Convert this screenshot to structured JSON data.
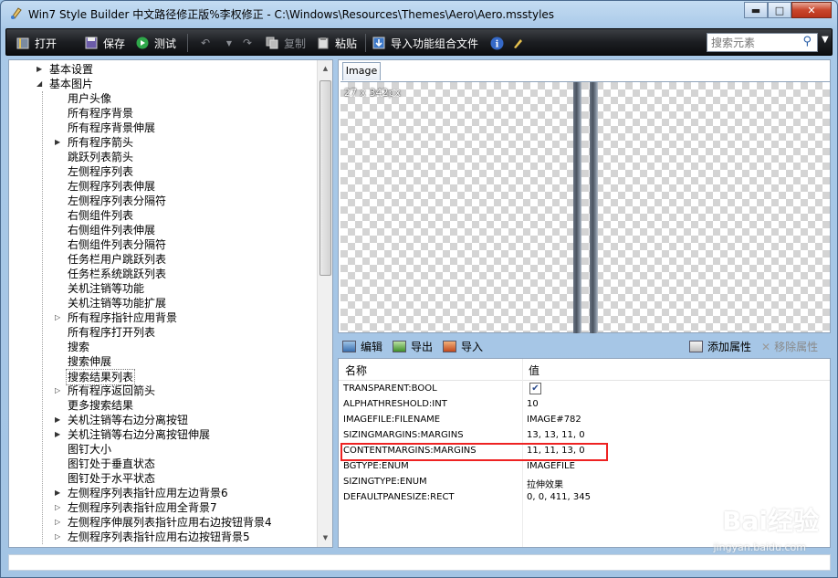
{
  "window": {
    "title": "Win7 Style Builder 中文路径修正版%李权修正 - C:\\Windows\\Resources\\Themes\\Aero\\Aero.msstyles",
    "minimize": "▬",
    "maximize": "□",
    "close": "✕"
  },
  "toolbar": {
    "open_label": "打开",
    "save_label": "保存",
    "test_label": "测试",
    "copy_label": "复制",
    "paste_label": "粘贴",
    "import_combo_label": "导入功能组合文件",
    "search_placeholder": "搜索元素"
  },
  "tree": {
    "items": [
      {
        "label": "基本设置",
        "arrow": "▶",
        "level": 0
      },
      {
        "label": "基本图片",
        "arrow": "◢",
        "level": 0
      },
      {
        "label": "用户头像",
        "arrow": "",
        "level": 1
      },
      {
        "label": "所有程序背景",
        "arrow": "",
        "level": 1
      },
      {
        "label": "所有程序背景伸展",
        "arrow": "",
        "level": 1
      },
      {
        "label": "所有程序箭头",
        "arrow": "▶",
        "level": 1
      },
      {
        "label": "跳跃列表箭头",
        "arrow": "",
        "level": 1
      },
      {
        "label": "左侧程序列表",
        "arrow": "",
        "level": 1
      },
      {
        "label": "左侧程序列表伸展",
        "arrow": "",
        "level": 1
      },
      {
        "label": "左侧程序列表分隔符",
        "arrow": "",
        "level": 1
      },
      {
        "label": "右侧组件列表",
        "arrow": "",
        "level": 1
      },
      {
        "label": "右侧组件列表伸展",
        "arrow": "",
        "level": 1
      },
      {
        "label": "右侧组件列表分隔符",
        "arrow": "",
        "level": 1
      },
      {
        "label": "任务栏用户跳跃列表",
        "arrow": "",
        "level": 1
      },
      {
        "label": "任务栏系统跳跃列表",
        "arrow": "",
        "level": 1
      },
      {
        "label": "关机注销等功能",
        "arrow": "",
        "level": 1
      },
      {
        "label": "关机注销等功能扩展",
        "arrow": "",
        "level": 1
      },
      {
        "label": "所有程序指针应用背景",
        "arrow": "▷",
        "level": 1
      },
      {
        "label": "所有程序打开列表",
        "arrow": "",
        "level": 1
      },
      {
        "label": "搜索",
        "arrow": "",
        "level": 1
      },
      {
        "label": "搜索伸展",
        "arrow": "",
        "level": 1
      },
      {
        "label": "搜索结果列表",
        "arrow": "",
        "level": 1,
        "selected": true
      },
      {
        "label": "所有程序返回箭头",
        "arrow": "▷",
        "level": 1
      },
      {
        "label": "更多搜索结果",
        "arrow": "",
        "level": 1
      },
      {
        "label": "关机注销等右边分离按钮",
        "arrow": "▶",
        "level": 1
      },
      {
        "label": "关机注销等右边分离按钮伸展",
        "arrow": "▶",
        "level": 1
      },
      {
        "label": "图钉大小",
        "arrow": "",
        "level": 1
      },
      {
        "label": "图钉处于垂直状态",
        "arrow": "",
        "level": 1
      },
      {
        "label": "图钉处于水平状态",
        "arrow": "",
        "level": 1
      },
      {
        "label": "左侧程序列表指针应用左边背景6",
        "arrow": "▶",
        "level": 1
      },
      {
        "label": "左侧程序列表指针应用全背景7",
        "arrow": "▷",
        "level": 1
      },
      {
        "label": "左侧程序伸展列表指针应用右边按钮背景4",
        "arrow": "▷",
        "level": 1
      },
      {
        "label": "左侧程序列表指针应用右边按钮背景5",
        "arrow": "▷",
        "level": 1
      }
    ]
  },
  "image_tab": {
    "label": "Image",
    "size_text": "27 x 342px"
  },
  "prop_toolbar": {
    "edit_label": "编辑",
    "export_label": "导出",
    "import_label": "导入",
    "add_prop_label": "添加属性",
    "remove_prop_label": "移除属性"
  },
  "props": {
    "header_name": "名称",
    "header_value": "值",
    "rows": [
      {
        "name": "TRANSPARENT:BOOL",
        "value": "",
        "checkbox": true
      },
      {
        "name": "ALPHATHRESHOLD:INT",
        "value": "10"
      },
      {
        "name": "IMAGEFILE:FILENAME",
        "value": "IMAGE#782"
      },
      {
        "name": "SIZINGMARGINS:MARGINS",
        "value": "13, 13, 11, 0"
      },
      {
        "name": "CONTENTMARGINS:MARGINS",
        "value": "11, 11, 13, 0"
      },
      {
        "name": "BGTYPE:ENUM",
        "value": "IMAGEFILE"
      },
      {
        "name": "SIZINGTYPE:ENUM",
        "value": "拉伸效果"
      },
      {
        "name": "DEFAULTPANESIZE:RECT",
        "value": "0, 0, 411, 345"
      }
    ]
  },
  "watermark": {
    "brand": "Bai经验",
    "sub": "jingyan.baidu.com"
  }
}
